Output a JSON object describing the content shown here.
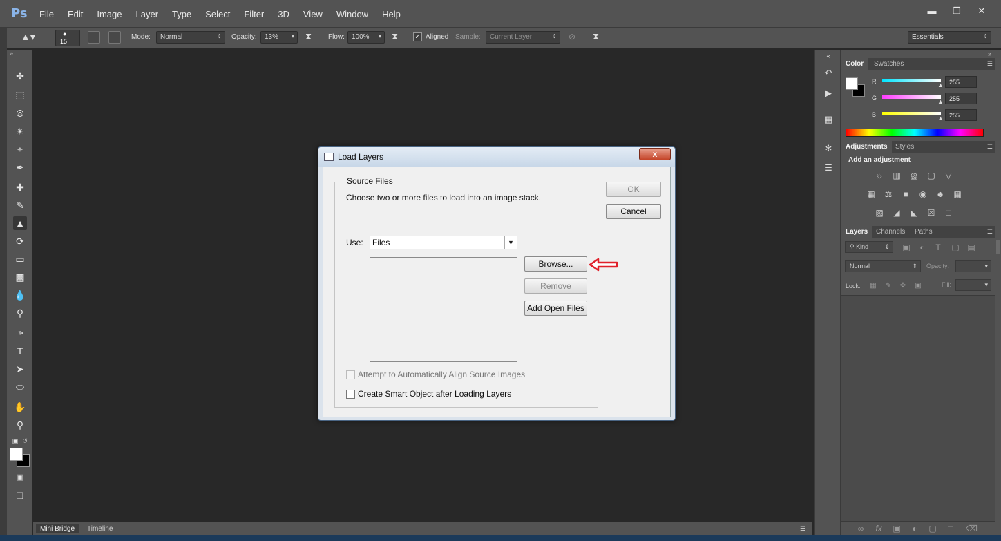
{
  "app": {
    "logo": "Ps",
    "menus": [
      "File",
      "Edit",
      "Image",
      "Layer",
      "Type",
      "Select",
      "Filter",
      "3D",
      "View",
      "Window",
      "Help"
    ],
    "window_controls": [
      "minimize",
      "maximize",
      "close"
    ]
  },
  "options_bar": {
    "brush_size": "15",
    "mode_label": "Mode:",
    "mode_value": "Normal",
    "opacity_label": "Opacity:",
    "opacity_value": "13%",
    "flow_label": "Flow:",
    "flow_value": "100%",
    "aligned_label": "Aligned",
    "aligned_checked": true,
    "sample_label": "Sample:",
    "sample_value": "Current Layer",
    "workspace_value": "Essentials"
  },
  "toolbar": {
    "tools": [
      "move-icon",
      "marquee-icon",
      "lasso-icon",
      "magic-wand-icon",
      "crop-icon",
      "eyedropper-icon",
      "healing-brush-icon",
      "brush-icon",
      "clone-stamp-icon",
      "history-brush-icon",
      "eraser-icon",
      "gradient-icon",
      "blur-icon",
      "dodge-icon",
      "pen-icon",
      "type-icon",
      "path-selection-icon",
      "shape-icon",
      "hand-icon",
      "zoom-icon"
    ],
    "selected_tool": "clone-stamp-icon",
    "foreground_color": "#ffffff",
    "background_color": "#000000"
  },
  "bottom_tabs": [
    "Mini Bridge",
    "Timeline"
  ],
  "color_panel": {
    "tabs": [
      "Color",
      "Swatches"
    ],
    "channels": [
      {
        "label": "R",
        "value": "255",
        "color": "#00e5ff"
      },
      {
        "label": "G",
        "value": "255",
        "color": "#ff3cff"
      },
      {
        "label": "B",
        "value": "255",
        "color": "#ffff00"
      }
    ]
  },
  "adjustments_panel": {
    "tabs": [
      "Adjustments",
      "Styles"
    ],
    "heading": "Add an adjustment"
  },
  "layers_panel": {
    "tabs": [
      "Layers",
      "Channels",
      "Paths"
    ],
    "kind_label": "Kind",
    "blend_mode": "Normal",
    "opacity_label": "Opacity:",
    "lock_label": "Lock:",
    "fill_label": "Fill:"
  },
  "dialog": {
    "title": "Load Layers",
    "group_label": "Source Files",
    "description": "Choose two or more files to load into an image stack.",
    "use_label": "Use:",
    "use_value": "Files",
    "buttons": {
      "ok": "OK",
      "cancel": "Cancel",
      "browse": "Browse...",
      "remove": "Remove",
      "add_open_files": "Add Open Files"
    },
    "align_checkbox": "Attempt to Automatically Align Source Images",
    "smart_object_checkbox": "Create Smart Object after Loading Layers",
    "close_glyph": "x"
  },
  "annotation": {
    "color": "#e0202a"
  }
}
